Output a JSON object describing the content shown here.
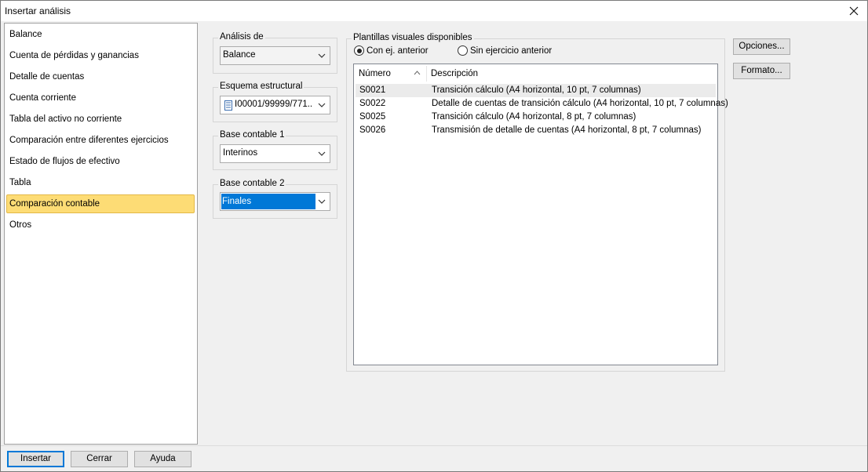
{
  "window": {
    "title": "Insertar análisis"
  },
  "nav": {
    "items": [
      {
        "label": "Balance"
      },
      {
        "label": "Cuenta de pérdidas y ganancias"
      },
      {
        "label": "Detalle de cuentas"
      },
      {
        "label": "Cuenta corriente"
      },
      {
        "label": "Tabla del activo no corriente"
      },
      {
        "label": "Comparación entre diferentes ejercicios"
      },
      {
        "label": "Estado de flujos de efectivo"
      },
      {
        "label": "Tabla"
      },
      {
        "label": "Comparación contable",
        "selected": true
      },
      {
        "label": "Otros"
      }
    ]
  },
  "analysis": {
    "label": "Análisis de",
    "value": "Balance"
  },
  "scheme": {
    "label": "Esquema estructural",
    "value": "I00001/99999/771..."
  },
  "base1": {
    "label": "Base contable 1",
    "value": "Interinos"
  },
  "base2": {
    "label": "Base contable 2",
    "value": "Finales"
  },
  "templates": {
    "label": "Plantillas visuales disponibles",
    "radio_with_prev": "Con ej. anterior",
    "radio_without_prev": "Sin ejercicio anterior",
    "selected_radio": "with_prev",
    "columns": {
      "number": "Número",
      "description": "Descripción"
    },
    "rows": [
      {
        "number": "S0021",
        "description": "Transición cálculo (A4 horizontal, 10 pt, 7 columnas)"
      },
      {
        "number": "S0022",
        "description": "Detalle de cuentas de transición cálculo (A4 horizontal, 10 pt, 7 columnas)"
      },
      {
        "number": "S0025",
        "description": "Transición cálculo (A4 horizontal, 8 pt, 7 columnas)"
      },
      {
        "number": "S0026",
        "description": "Transmisión de detalle de cuentas (A4 horizontal, 8 pt, 7 columnas)"
      }
    ]
  },
  "side_buttons": {
    "options": "Opciones...",
    "format": "Formato..."
  },
  "footer": {
    "insert": "Insertar",
    "close": "Cerrar",
    "help": "Ayuda"
  },
  "icons": {
    "close": "close-icon",
    "dropdown": "chevron-down-icon",
    "sort": "sort-ascending-icon",
    "scheme": "structure-document-icon"
  },
  "colors": {
    "selection": "#fddc75",
    "selection_border": "#e3b848",
    "accent": "#0078d7",
    "row_highlight": "#ebebeb"
  }
}
